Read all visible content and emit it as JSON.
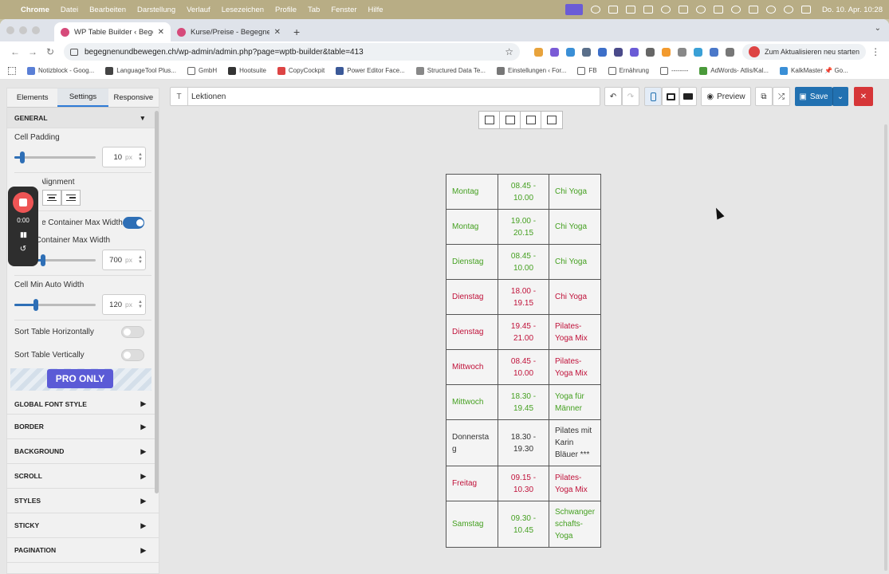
{
  "menubar": {
    "app": "Chrome",
    "items": [
      "Datei",
      "Bearbeiten",
      "Darstellung",
      "Verlauf",
      "Lesezeichen",
      "Profile",
      "Tab",
      "Fenster",
      "Hilfe"
    ],
    "clock": "Do. 10. Apr.  10:28"
  },
  "browser": {
    "tabs": [
      {
        "label": "WP Table Builder ‹ Begegnen",
        "active": true
      },
      {
        "label": "Kurse/Preise - Begegnen&Be",
        "active": false
      }
    ],
    "url": "begegnenundbewegen.ch/wp-admin/admin.php?page=wptb-builder&table=413",
    "update_label": "Zum Aktualisieren neu starten",
    "bookmarks": [
      "Notizblock - Goog...",
      "LanguageTool Plus...",
      "GmbH",
      "Hootsuite",
      "CopyCockpit",
      "Power Editor Face...",
      "Structured Data Te...",
      "Einstellungen ‹ For...",
      "FB",
      "Ernährung",
      "--------",
      "AdWords- Atlis/Kal...",
      "KalkMaster 📌 Go..."
    ]
  },
  "panel": {
    "tabs": [
      "Elements",
      "Settings",
      "Responsive"
    ],
    "general_label": "GENERAL",
    "cell_padding": {
      "label": "Cell Padding",
      "value": "10",
      "unit": "px",
      "fraction": 0.1
    },
    "alignment_label": "Alignment",
    "container_toggle_label": "Table Container Max Width",
    "container_max": {
      "label": "Table Container Max Width",
      "value": "700",
      "unit": "px",
      "fraction": 0.35
    },
    "cell_min": {
      "label": "Cell Min Auto Width",
      "value": "120",
      "unit": "px",
      "fraction": 0.26
    },
    "sort_h": "Sort Table Horizontally",
    "sort_v": "Sort Table Vertically",
    "pro_label": "PRO ONLY",
    "sections": [
      "GLOBAL FONT STYLE",
      "BORDER",
      "BACKGROUND",
      "SCROLL",
      "STYLES",
      "STICKY",
      "PAGINATION"
    ]
  },
  "recorder": {
    "time": "0:00"
  },
  "toolbar": {
    "title_value": "Lektionen",
    "preview_label": "Preview",
    "save_label": "Save"
  },
  "table": {
    "rows": [
      {
        "tone": "green",
        "cells": [
          "Montag",
          "08.45 -\n10.00",
          "Chi Yoga"
        ]
      },
      {
        "tone": "green",
        "cells": [
          "Montag",
          "19.00 -\n20.15",
          "Chi Yoga"
        ]
      },
      {
        "tone": "green",
        "cells": [
          "Dienstag",
          "08.45 -\n10.00",
          "Chi Yoga"
        ]
      },
      {
        "tone": "pink",
        "cells": [
          "Dienstag",
          "18.00 -\n19.15",
          "Chi Yoga"
        ]
      },
      {
        "tone": "pink",
        "cells": [
          "Dienstag",
          "19.45 -\n21.00",
          "Pilates-\nYoga Mix"
        ]
      },
      {
        "tone": "pink",
        "cells": [
          "Mittwoch",
          "08.45 -\n10.00",
          "Pilates-\nYoga Mix"
        ]
      },
      {
        "tone": "green",
        "cells": [
          "Mittwoch",
          "18.30 -\n19.45",
          "Yoga für\nMänner"
        ]
      },
      {
        "tone": "dark",
        "cells": [
          "Donnersta\ng",
          "18.30 -\n19.30",
          "Pilates mit\nKarin\nBläuer ***"
        ]
      },
      {
        "tone": "pink",
        "cells": [
          "Freitag",
          "09.15 -\n10.30",
          "Pilates-\nYoga Mix"
        ]
      },
      {
        "tone": "green",
        "cells": [
          "Samstag",
          "09.30 -\n10.45",
          "Schwanger\nschafts-\nYoga"
        ]
      }
    ]
  },
  "colors": {
    "green": "#45a021",
    "pink": "#c0123a",
    "accent": "#2271b1"
  }
}
